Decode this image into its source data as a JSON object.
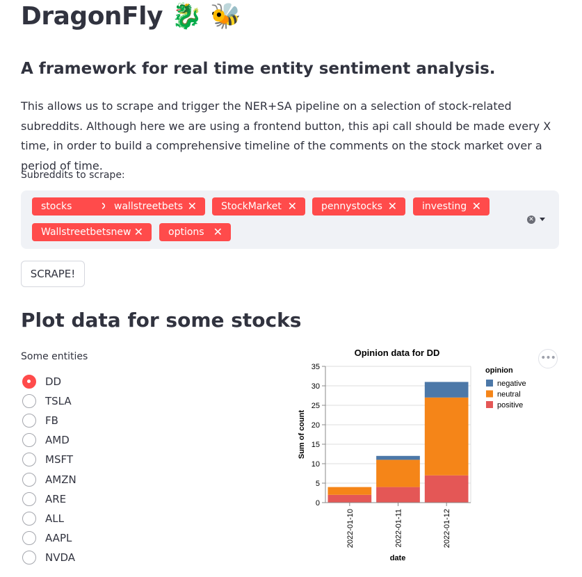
{
  "header": {
    "title": "DragonFly 🐉 🐝"
  },
  "subtitle": "A framework for real time entity sentiment analysis.",
  "description": "This allows us to scrape and trigger the NER+SA pipeline on a selection of stock-related subreddits. Although here we are using a frontend button, this api call should be made every X time, in order to build a comprehensive timeline of the comments on the stock market over a period of time.",
  "subreddits": {
    "label": "Subreddits to scrape:",
    "tags": [
      "stocks",
      "wallstreetbets",
      "StockMarket",
      "pennystocks",
      "investing",
      "Wallstreetbetsnew",
      "options"
    ],
    "remove_icon": "close-icon",
    "tag_color": "#ff4b4b"
  },
  "scrape_button": "SCRAPE!",
  "plot_section": {
    "heading": "Plot data for some stocks",
    "entities_label": "Some entities",
    "entities": [
      "DD",
      "TSLA",
      "FB",
      "AMD",
      "MSFT",
      "AMZN",
      "ARE",
      "ALL",
      "AAPL",
      "NVDA"
    ],
    "selected": "DD"
  },
  "chart_menu": "•••",
  "chart_data": {
    "type": "bar",
    "stacked": true,
    "title": "Opinion data for DD",
    "xlabel": "date",
    "ylabel": "Sum of count",
    "categories": [
      "2022-01-10",
      "2022-01-11",
      "2022-01-12"
    ],
    "series": [
      {
        "name": "positive",
        "color": "#e45756",
        "values": [
          2,
          4,
          7
        ]
      },
      {
        "name": "neutral",
        "color": "#f58518",
        "values": [
          2,
          7,
          20
        ]
      },
      {
        "name": "negative",
        "color": "#4c78a8",
        "values": [
          0,
          1,
          4
        ]
      }
    ],
    "ylim": [
      0,
      35
    ],
    "yticks": [
      0,
      5,
      10,
      15,
      20,
      25,
      30,
      35
    ],
    "legend_title": "opinion",
    "legend_order": [
      "negative",
      "neutral",
      "positive"
    ],
    "legend_position": "right"
  }
}
